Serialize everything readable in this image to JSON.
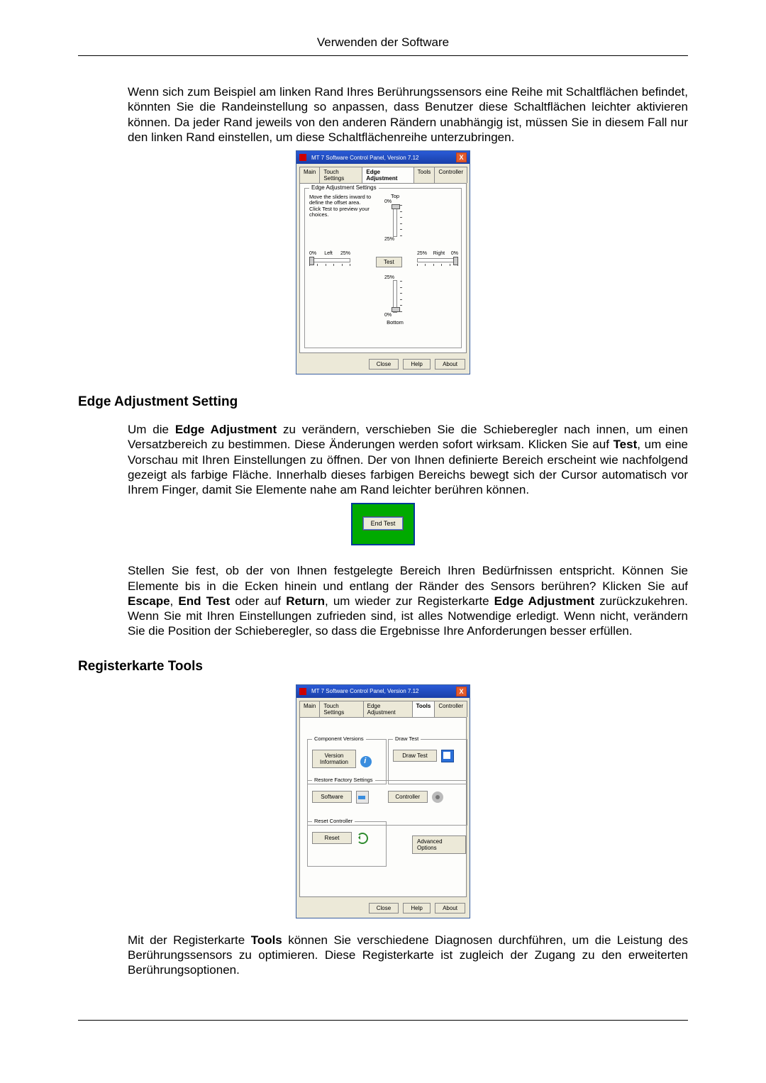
{
  "header": {
    "title": "Verwenden der Software"
  },
  "para1": "Wenn sich zum Beispiel am linken Rand Ihres Berührungssensors eine Reihe mit Schaltflächen befindet, könnten Sie die Randeinstellung so anpassen, dass Benutzer diese Schaltflächen leichter aktivieren können. Da jeder Rand jeweils von den anderen Rändern unabhängig ist, müssen Sie in diesem Fall nur den linken Rand einstellen, um diese Schaltflächenreihe unterzubringen.",
  "dlg": {
    "title": "MT 7 Software Control Panel, Version 7.12",
    "tabs": {
      "main": "Main",
      "touch": "Touch Settings",
      "edge": "Edge Adjustment",
      "tools": "Tools",
      "controller": "Controller"
    },
    "edge_group": "Edge Adjustment Settings",
    "instructions": "Move the sliders inward to define the offset area. Click Test to preview your choices.",
    "top": "Top",
    "bottom": "Bottom",
    "left": "Left",
    "right": "Right",
    "pct0": "0%",
    "pct25": "25%",
    "test": "Test",
    "close": "Close",
    "help": "Help",
    "about": "About"
  },
  "section1": "Edge Adjustment Setting",
  "para2_a": "Um die ",
  "para2_b": "Edge Adjustment",
  "para2_c": " zu verändern, verschieben Sie die Schieberegler nach innen, um einen Versatzbereich zu bestimmen. Diese Änderungen werden sofort wirksam. Klicken Sie auf ",
  "para2_d": "Test",
  "para2_e": ", um eine Vorschau mit Ihren Einstellungen zu öffnen. Der von Ihnen definierte Bereich erscheint wie nachfolgend gezeigt als farbige Fläche. Innerhalb dieses farbigen Bereichs bewegt sich der Cursor automatisch vor Ihrem Finger, damit Sie Elemente nahe am Rand leichter berühren können.",
  "endtest": "End Test",
  "para3_a": "Stellen Sie fest, ob der von Ihnen festgelegte Bereich Ihren Bedürfnissen entspricht. Können Sie Elemente bis in die Ecken hinein und entlang der Ränder des Sensors berühren? Klicken Sie auf ",
  "para3_b": "Escape",
  "para3_c": ", ",
  "para3_d": "End Test",
  "para3_e": " oder auf ",
  "para3_f": "Return",
  "para3_g": ", um wieder zur Registerkarte ",
  "para3_h": "Edge Adjustment",
  "para3_i": " zurückzukehren. Wenn Sie mit Ihren Einstellungen zufrieden sind, ist alles Notwendige erledigt. Wenn nicht, verändern Sie die Position der Schieberegler, so dass die Ergebnisse Ihre Anforderungen besser erfüllen.",
  "section2": "Registerkarte Tools",
  "tools": {
    "comp_versions": "Component Versions",
    "version_info": "Version Information",
    "draw_test_group": "Draw Test",
    "draw_test": "Draw Test",
    "restore": "Restore Factory Settings",
    "software": "Software",
    "controller": "Controller",
    "reset_controller": "Reset Controller",
    "reset": "Reset",
    "advanced": "Advanced Options"
  },
  "para4_a": "Mit der Registerkarte ",
  "para4_b": "Tools",
  "para4_c": " können Sie verschiedene Diagnosen durchführen, um die Leistung des Berührungssensors zu optimieren. Diese Registerkarte ist zugleich der Zugang zu den erweiterten Berührungsoptionen."
}
